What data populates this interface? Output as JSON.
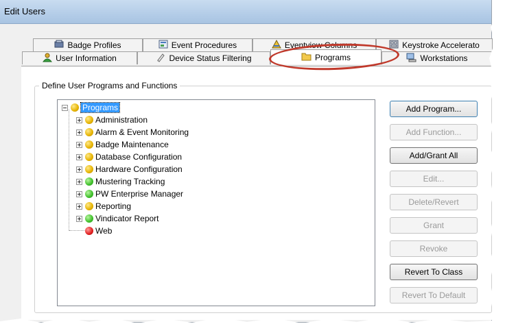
{
  "window": {
    "title": "Edit Users"
  },
  "tabs": {
    "row1": [
      {
        "label": "Badge Profiles",
        "icon": "badge-profiles-icon"
      },
      {
        "label": "Event Procedures",
        "icon": "event-procedures-icon"
      },
      {
        "label": "Eventview Columns",
        "icon": "eventview-columns-icon"
      },
      {
        "label": "Keystroke Accelerato",
        "icon": "keystroke-icon"
      }
    ],
    "row2": [
      {
        "label": "User Information",
        "icon": "user-icon"
      },
      {
        "label": "Device Status Filtering",
        "icon": "filter-icon"
      },
      {
        "label": "Programs",
        "icon": "folder-icon",
        "active": true
      },
      {
        "label": "Workstations",
        "icon": "workstation-icon"
      }
    ]
  },
  "group": {
    "title": "Define User Programs and Functions"
  },
  "tree": {
    "root": {
      "label": "Programs",
      "status": "yellow",
      "selected": true
    },
    "children": [
      {
        "label": "Administration",
        "status": "yellow",
        "expandable": true
      },
      {
        "label": "Alarm & Event Monitoring",
        "status": "yellow",
        "expandable": true
      },
      {
        "label": "Badge Maintenance",
        "status": "yellow",
        "expandable": true
      },
      {
        "label": "Database Configuration",
        "status": "yellow",
        "expandable": true
      },
      {
        "label": "Hardware Configuration",
        "status": "yellow",
        "expandable": true
      },
      {
        "label": "Mustering Tracking",
        "status": "green",
        "expandable": true
      },
      {
        "label": "PW Enterprise Manager",
        "status": "green",
        "expandable": true
      },
      {
        "label": "Reporting",
        "status": "yellow",
        "expandable": true
      },
      {
        "label": "Vindicator Report",
        "status": "green",
        "expandable": true
      },
      {
        "label": "Web",
        "status": "red",
        "expandable": false
      }
    ]
  },
  "buttons": [
    {
      "label": "Add Program...",
      "enabled": true
    },
    {
      "label": "Add Function...",
      "enabled": false
    },
    {
      "label": "Add/Grant All",
      "enabled": true
    },
    {
      "label": "Edit...",
      "enabled": false
    },
    {
      "label": "Delete/Revert",
      "enabled": false
    },
    {
      "label": "Grant",
      "enabled": false
    },
    {
      "label": "Revoke",
      "enabled": false
    },
    {
      "label": "Revert To Class",
      "enabled": true
    },
    {
      "label": "Revert To Default",
      "enabled": false
    }
  ],
  "colors": {
    "selection": "#3399ff",
    "annotation": "#c0392b",
    "status_yellow": "#e6b300",
    "status_green": "#3fbf2a",
    "status_red": "#e02020"
  }
}
